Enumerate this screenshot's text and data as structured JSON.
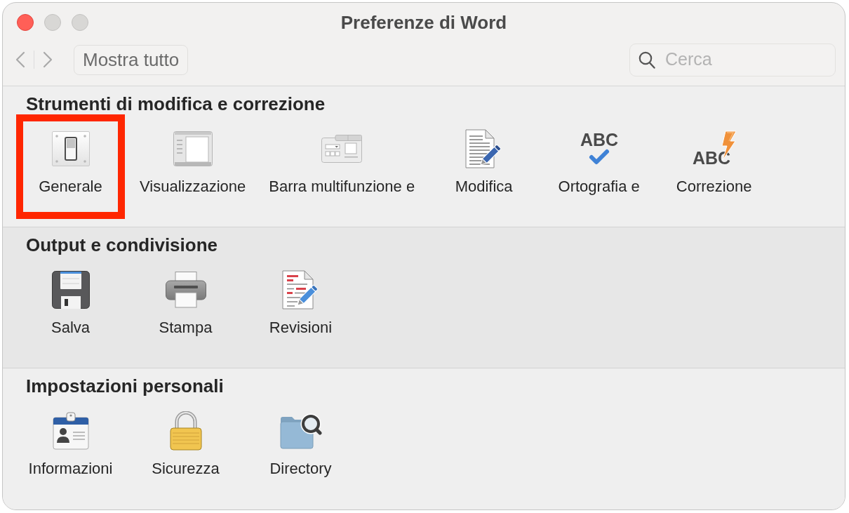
{
  "window": {
    "title": "Preferenze di Word",
    "controls": [
      {
        "kind": "close",
        "disabled": false
      },
      {
        "kind": "minimize",
        "disabled": true
      },
      {
        "kind": "zoom",
        "disabled": true
      }
    ]
  },
  "toolbar": {
    "navigation": [
      {
        "kind": "back",
        "disabled": true
      },
      {
        "kind": "forward",
        "disabled": true
      }
    ],
    "show_all_button": "Mostra tutto",
    "search": {
      "placeholder": "Cerca"
    }
  },
  "sections": [
    {
      "title": "Strumenti di modifica e correzione",
      "items": [
        {
          "label": "Generale",
          "kind": "switch",
          "highlighted": true
        },
        {
          "label": "Visualizzazione",
          "kind": "layout",
          "highlighted": false
        },
        {
          "label": "Barra multifunzione e",
          "kind": "ribbon",
          "highlighted": false
        },
        {
          "label": "Modifica",
          "kind": "edit",
          "highlighted": false
        },
        {
          "label": "Ortografia e",
          "kind": "spelling",
          "glyph": "ABC",
          "highlighted": false
        },
        {
          "label": "Correzione",
          "kind": "autocorrect",
          "glyph": "ABC",
          "highlighted": false
        }
      ]
    },
    {
      "title": "Output e condivisione",
      "items": [
        {
          "label": "Salva",
          "kind": "save",
          "highlighted": false
        },
        {
          "label": "Stampa",
          "kind": "print",
          "highlighted": false
        },
        {
          "label": "Revisioni",
          "kind": "revisions",
          "highlighted": false
        }
      ]
    },
    {
      "title": "Impostazioni personali",
      "items": [
        {
          "label": "Informazioni",
          "kind": "badge",
          "highlighted": false
        },
        {
          "label": "Sicurezza",
          "kind": "lock",
          "highlighted": false
        },
        {
          "label": "Directory",
          "kind": "folder",
          "highlighted": false
        }
      ]
    }
  ]
}
